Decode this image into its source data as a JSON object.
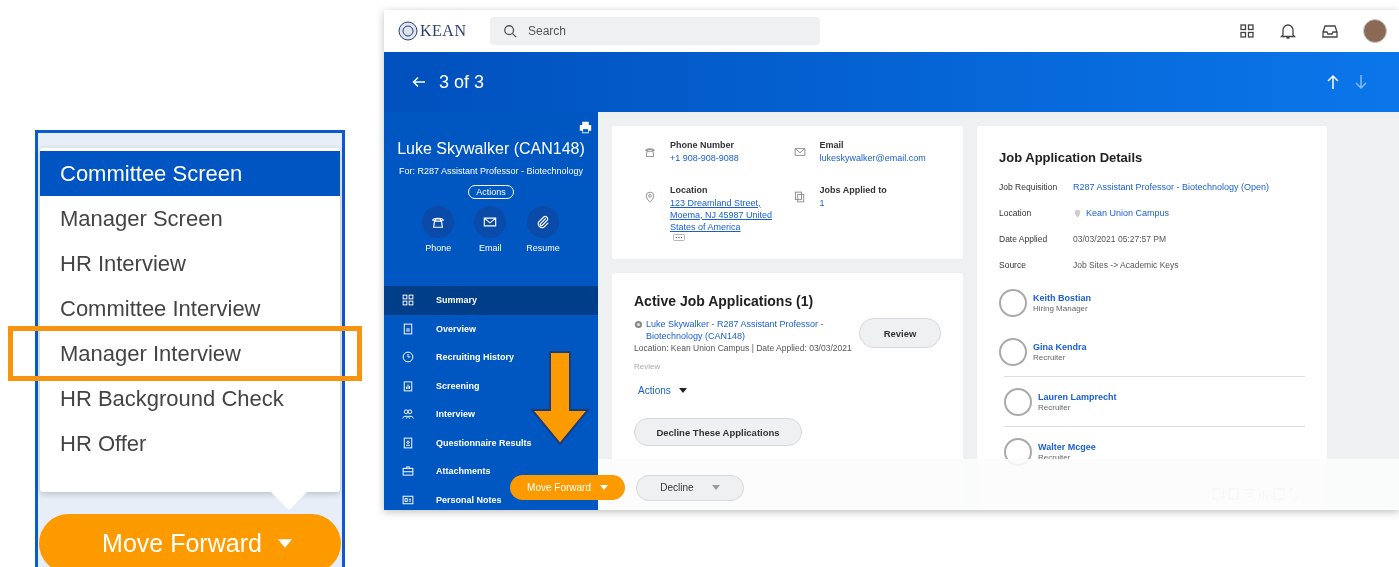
{
  "callout": {
    "menu_items": [
      {
        "label": "Committee Screen",
        "selected": true,
        "highlighted": false
      },
      {
        "label": "Manager Screen",
        "selected": false,
        "highlighted": false
      },
      {
        "label": "HR Interview",
        "selected": false,
        "highlighted": false
      },
      {
        "label": "Committee Interview",
        "selected": false,
        "highlighted": false
      },
      {
        "label": "Manager Interview",
        "selected": false,
        "highlighted": true
      },
      {
        "label": "HR Background Check",
        "selected": false,
        "highlighted": false
      },
      {
        "label": "HR Offer",
        "selected": false,
        "highlighted": false
      }
    ],
    "button": "Move Forward"
  },
  "topbar": {
    "logo": "KEAN",
    "search": {
      "placeholder": "Search"
    }
  },
  "header": {
    "title": "3 of 3"
  },
  "sidebar": {
    "name": "Luke Skywalker (CAN148)",
    "subtitle": "For: R287 Assistant Professor - Biotechnology",
    "actions": "Actions",
    "quick_actions": [
      {
        "label": "Phone",
        "kind": "phone"
      },
      {
        "label": "Email",
        "kind": "email"
      },
      {
        "label": "Resume",
        "kind": "clip"
      }
    ],
    "items": [
      {
        "label": "Summary",
        "kind": "grid",
        "selected": true
      },
      {
        "label": "Overview",
        "kind": "doc",
        "selected": false
      },
      {
        "label": "Recruiting History",
        "kind": "clock",
        "selected": false
      },
      {
        "label": "Screening",
        "kind": "clipboard",
        "selected": false
      },
      {
        "label": "Interview",
        "kind": "people",
        "selected": false
      },
      {
        "label": "Questionnaire Results",
        "kind": "badge",
        "selected": false
      },
      {
        "label": "Attachments",
        "kind": "case",
        "selected": false
      },
      {
        "label": "Personal Notes",
        "kind": "card",
        "selected": false
      }
    ]
  },
  "contact": {
    "fields": [
      {
        "label": "Phone Number",
        "value": "+1 908-908-9088",
        "kind": "phone",
        "underlined": false
      },
      {
        "label": "Email",
        "value": "lukeskywalker@email.com",
        "kind": "email",
        "underlined": false
      },
      {
        "label": "Location",
        "value": "123 Dreamland Street, Moema, NJ 45987 United States of America",
        "kind": "pin",
        "underlined": true
      },
      {
        "label": "Jobs Applied to",
        "value": "1",
        "kind": "jobs",
        "underlined": false
      }
    ]
  },
  "active_applications": {
    "title": "Active Job Applications (1)",
    "link": "Luke Skywalker - R287 Assistant Professor - Biotechnology (CAN148)",
    "meta": "Location: Kean Union Campus | Date Applied: 03/03/2021",
    "status": "Review",
    "review_button": "Review",
    "actions": "Actions",
    "decline_button": "Decline These Applications"
  },
  "details": {
    "title": "Job Application Details",
    "rows": [
      {
        "label": "Job Requisition",
        "value": "R287 Assistant Professor - Biotechnology (Open)",
        "kind": "link"
      },
      {
        "label": "Location",
        "value": "Kean Union Campus",
        "kind": "place"
      },
      {
        "label": "Date Applied",
        "value": "03/03/2021 05:27:57 PM",
        "kind": "text"
      },
      {
        "label": "Source",
        "value": "Job Sites -> Academic Keys",
        "kind": "text"
      }
    ],
    "people": [
      {
        "name": "Keith Bostian",
        "role": "Hiring Manager"
      },
      {
        "name": "Gina Kendra",
        "role": "Recruiter"
      },
      {
        "name": "Lauren Lamprecht",
        "role": "Recruiter"
      },
      {
        "name": "Walter Mcgee",
        "role": "Recruiter"
      }
    ]
  },
  "action_bar": {
    "primary": "Move Forward",
    "secondary": "Decline"
  }
}
